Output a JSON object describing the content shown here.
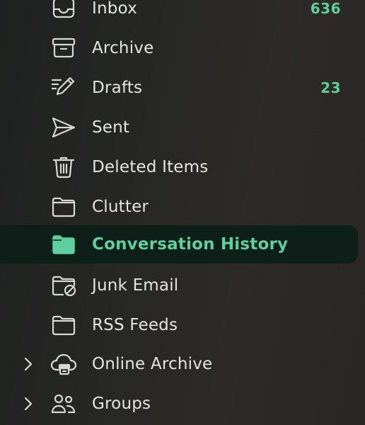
{
  "folders": [
    {
      "label": "Inbox",
      "count": "636",
      "icon": "inbox-icon"
    },
    {
      "label": "Archive",
      "count": "",
      "icon": "archive-icon"
    },
    {
      "label": "Drafts",
      "count": "23",
      "icon": "drafts-pencil-icon"
    },
    {
      "label": "Sent",
      "count": "",
      "icon": "sent-paper-plane-icon"
    },
    {
      "label": "Deleted Items",
      "count": "",
      "icon": "trash-icon"
    },
    {
      "label": "Clutter",
      "count": "",
      "icon": "folder-icon"
    },
    {
      "label": "Conversation History",
      "count": "",
      "icon": "folder-filled-icon",
      "selected": true
    },
    {
      "label": "Junk Email",
      "count": "",
      "icon": "junk-folder-icon"
    },
    {
      "label": "RSS Feeds",
      "count": "",
      "icon": "folder-icon"
    },
    {
      "label": "Online Archive",
      "count": "",
      "icon": "cloud-archive-icon",
      "expandable": true
    },
    {
      "label": "Groups",
      "count": "",
      "icon": "groups-icon",
      "expandable": true
    }
  ],
  "colors": {
    "accent": "#5fcf9e",
    "selected_background": "#0e1e19",
    "text": "#e4e4e1",
    "icon": "#d8d8d4"
  }
}
